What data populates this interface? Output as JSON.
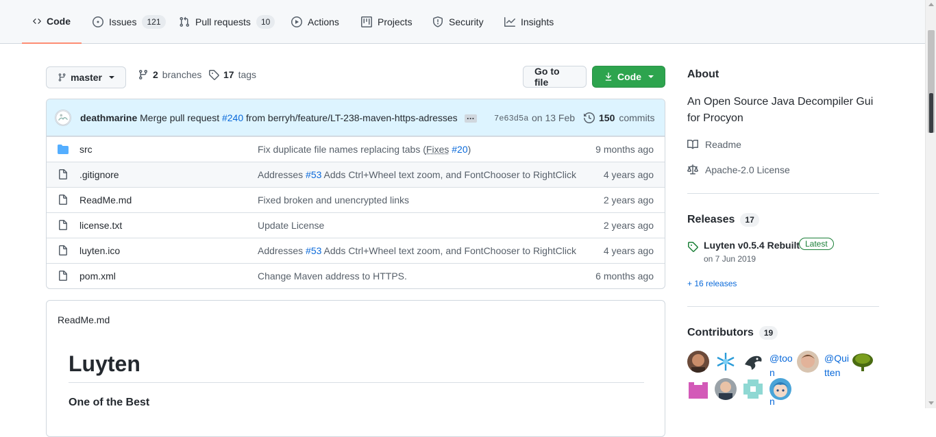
{
  "nav": {
    "tabs": [
      {
        "label": "Code",
        "icon": "code-icon",
        "active": true
      },
      {
        "label": "Issues",
        "icon": "issue-opened-icon",
        "count": "121"
      },
      {
        "label": "Pull requests",
        "icon": "git-pull-request-icon",
        "count": "10"
      },
      {
        "label": "Actions",
        "icon": "play-icon"
      },
      {
        "label": "Projects",
        "icon": "table-icon"
      },
      {
        "label": "Security",
        "icon": "shield-icon"
      },
      {
        "label": "Insights",
        "icon": "graph-icon"
      }
    ]
  },
  "branchbar": {
    "branch": "master",
    "branches_count": "2",
    "branches_label": "branches",
    "tags_count": "17",
    "tags_label": "tags",
    "go_to_file": "Go to file",
    "code_button": "Code"
  },
  "commit": {
    "author": "deathmarine",
    "message_pre": "Merge pull request",
    "pr": "#240",
    "message_post": "from berryh/feature/LT-238-maven-https-adresses",
    "ellipsis": "…",
    "sha": "7e63d5a",
    "date": "on 13 Feb",
    "commits_count": "150",
    "commits_label": "commits"
  },
  "files": [
    {
      "name": "src",
      "type": "dir",
      "msg_pre": "Fix duplicate file names replacing tabs (",
      "msg_link1": "Fixes",
      "msg_mid": " ",
      "msg_link2": "#20",
      "msg_post": ")",
      "age": "9 months ago"
    },
    {
      "name": ".gitignore",
      "type": "file",
      "msg_pre": "Addresses ",
      "msg_link2": "#53",
      "msg_post": " Adds Ctrl+Wheel text zoom, and FontChooser to RightClick",
      "age": "4 years ago"
    },
    {
      "name": "ReadMe.md",
      "type": "file",
      "msg_pre": "Fixed broken and unencrypted links",
      "age": "2 years ago"
    },
    {
      "name": "license.txt",
      "type": "file",
      "msg_pre": "Update License",
      "age": "2 years ago"
    },
    {
      "name": "luyten.ico",
      "type": "file",
      "msg_pre": "Addresses ",
      "msg_link2": "#53",
      "msg_post": " Adds Ctrl+Wheel text zoom, and FontChooser to RightClick",
      "age": "4 years ago"
    },
    {
      "name": "pom.xml",
      "type": "file",
      "msg_pre": "Change Maven address to HTTPS.",
      "age": "6 months ago"
    }
  ],
  "readme": {
    "file_label": "ReadMe.md",
    "heading": "Luyten",
    "subheading": "One of the Best"
  },
  "about": {
    "title": "About",
    "description": "An Open Source Java Decompiler Gui for Procyon",
    "readme_link": "Readme",
    "license_link": "Apache-2.0 License"
  },
  "releases": {
    "title": "Releases",
    "count": "17",
    "latest_name": "Luyten v0.5.4 Rebuilt",
    "latest_badge": "Latest",
    "latest_date": "on 7 Jun 2019",
    "more": "+ 16 releases"
  },
  "contributors": {
    "title": "Contributors",
    "count": "19",
    "broken_alt_1": "@toon",
    "broken_alt_2": "@Quitten",
    "broken_alt_3": "n"
  },
  "colors": {
    "accent_tab": "#fd8c73",
    "primary_button": "#2da44e",
    "commit_bar": "#ddf4ff",
    "link": "#0969da",
    "latest_badge": "#1a7f37"
  }
}
